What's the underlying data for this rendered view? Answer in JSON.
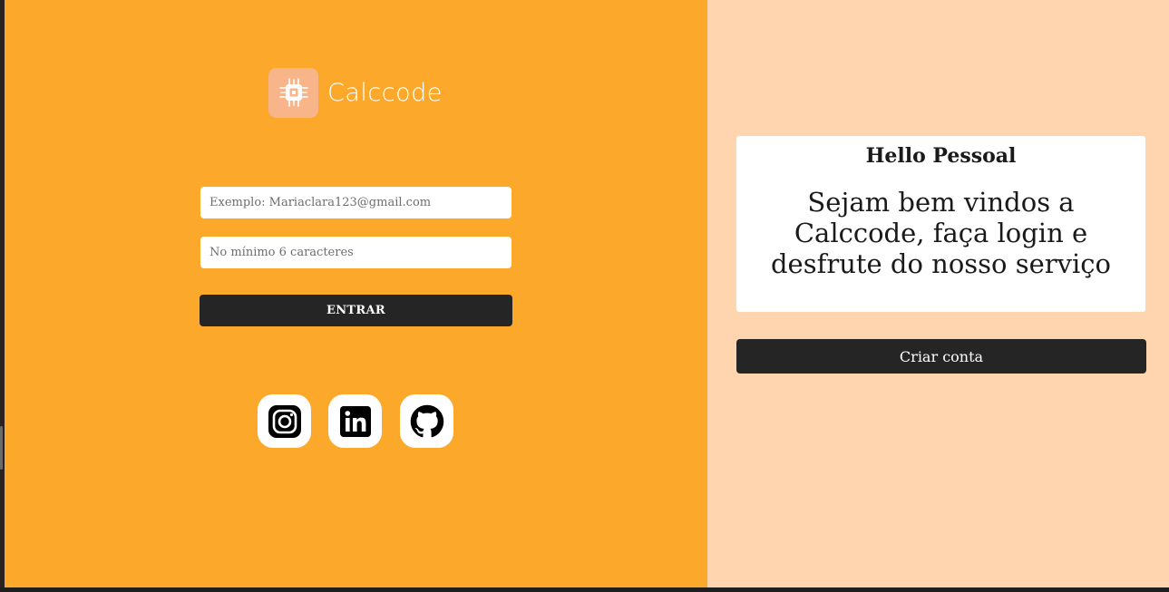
{
  "brand": {
    "name": "Calccode",
    "icon": "chip-icon",
    "tile_color": "#f9b58a"
  },
  "login_form": {
    "email_placeholder": "Exemplo: Mariaclara123@gmail.com",
    "email_value": "",
    "password_placeholder": "No mínimo 6 caracteres",
    "password_value": "",
    "submit_label": "ENTRAR"
  },
  "social_links": [
    {
      "name": "instagram-icon"
    },
    {
      "name": "linkedin-icon"
    },
    {
      "name": "github-icon"
    }
  ],
  "welcome": {
    "greeting": "Hello Pessoal",
    "message": "Sejam bem vindos a Calccode, faça login e desfrute do nosso serviço"
  },
  "signup": {
    "button_label": "Criar conta"
  },
  "colors": {
    "left_background": "#fca92b",
    "right_background": "#fed5ae",
    "button_dark": "#252525",
    "card_white": "#ffffff"
  }
}
